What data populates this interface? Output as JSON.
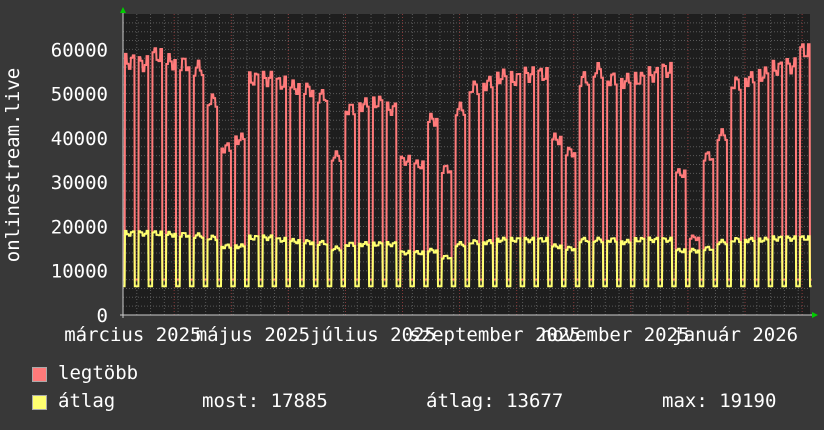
{
  "chart_data": {
    "type": "line",
    "ylabel": "onlinestream.live",
    "ylim": [
      0,
      68000
    ],
    "yticks": [
      0,
      10000,
      20000,
      30000,
      40000,
      50000,
      60000
    ],
    "x_range": [
      "2025-02-24",
      "2026-02-08"
    ],
    "xticks": [
      {
        "date": "2025-03-01",
        "label": "március 2025"
      },
      {
        "date": "2025-05-01",
        "label": "május 2025"
      },
      {
        "date": "2025-07-01",
        "label": "július 2025"
      },
      {
        "date": "2025-09-01",
        "label": "szeptember 2025"
      },
      {
        "date": "2025-11-01",
        "label": "november 2025"
      },
      {
        "date": "2026-01-01",
        "label": "január 2026"
      }
    ],
    "grid": true,
    "colors": {
      "background": "#383838",
      "plot": "#1e1e1e",
      "grid": "#5a5a5a",
      "major_grid": "#8a3a3a",
      "arrow": "#00cc00"
    },
    "series": [
      {
        "name": "legtöbb",
        "color": "#ff7a7a",
        "weekly_weekday_peak": [
          59000,
          58500,
          60500,
          59000,
          58500,
          57500,
          50000,
          39000,
          41000,
          55000,
          55000,
          54000,
          53000,
          52500,
          51000,
          37000,
          48000,
          49000,
          49500,
          48000,
          36000,
          35000,
          45500,
          34000,
          48000,
          53000,
          54000,
          55500,
          55000,
          56000,
          56000,
          41000,
          38000,
          55000,
          57000,
          55000,
          54500,
          55000,
          56000,
          57000,
          33000,
          18000,
          37000,
          42000,
          54000,
          55000,
          56000,
          57500,
          58000,
          61500
        ],
        "weekend_low": 8000
      },
      {
        "name": "átlag",
        "color": "#ffff70",
        "weekly_weekday_peak": [
          19000,
          19000,
          19000,
          18800,
          18700,
          18500,
          18000,
          16000,
          16000,
          18000,
          18000,
          17500,
          17200,
          17000,
          16800,
          15500,
          16500,
          16500,
          16500,
          16500,
          14500,
          14500,
          15000,
          13500,
          16500,
          17000,
          17000,
          17500,
          17500,
          17500,
          17500,
          16000,
          15500,
          17500,
          17500,
          17500,
          17000,
          17500,
          17500,
          17500,
          15000,
          15000,
          15500,
          17000,
          17500,
          17500,
          17500,
          17800,
          17800,
          17885
        ],
        "weekend_low": 6500
      }
    ],
    "legend": {
      "placement": "bottom-left",
      "max_label": "legtöbb",
      "avg_label": "átlag",
      "now": "most: 17885",
      "average": "átlag: 13677",
      "max": "max: 19190"
    }
  }
}
